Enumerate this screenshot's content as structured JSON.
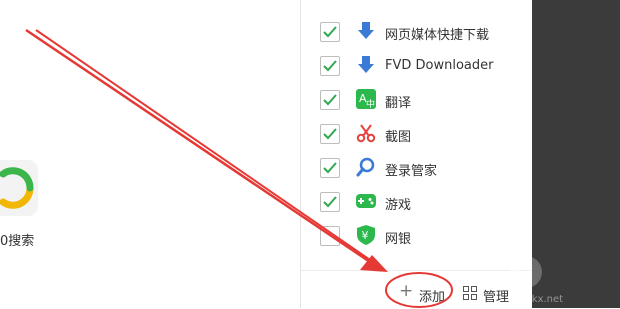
{
  "extensions": [
    {
      "label": "网页媒体快捷下载",
      "checked": true,
      "icon": "download-icon",
      "color": "#3a7bd5"
    },
    {
      "label": "FVD Downloader",
      "checked": true,
      "icon": "download-icon",
      "color": "#3a7bd5"
    },
    {
      "label": "翻译",
      "checked": true,
      "icon": "translate-icon",
      "color": "#2db84d"
    },
    {
      "label": "截图",
      "checked": true,
      "icon": "scissors-icon",
      "color": "#e8423f"
    },
    {
      "label": "登录管家",
      "checked": true,
      "icon": "search-key-icon",
      "color": "#3a7bd5"
    },
    {
      "label": "游戏",
      "checked": true,
      "icon": "gamepad-icon",
      "color": "#2db84d"
    },
    {
      "label": "网银",
      "checked": false,
      "icon": "shield-yen-icon",
      "color": "#2db84d"
    }
  ],
  "footer": {
    "add_label": "添加",
    "manage_label": "管理"
  },
  "background_app": {
    "label": "0搜索"
  },
  "colors": {
    "annotation_red": "#e53935",
    "check_green": "#2fa84f"
  }
}
